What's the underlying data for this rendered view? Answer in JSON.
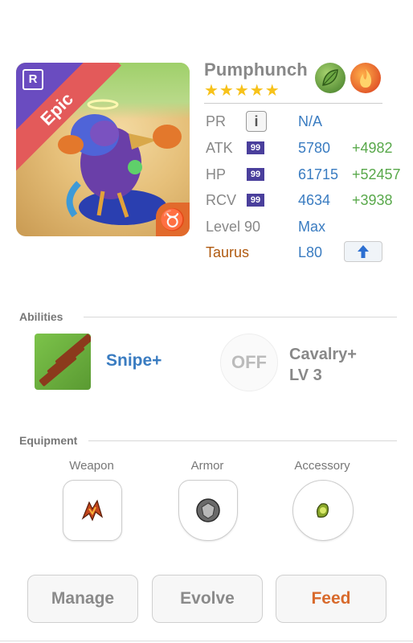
{
  "monster": {
    "name": "Pumphunch",
    "stars": "★★★★★",
    "rarity_badge": "R",
    "rarity": "Epic",
    "sign_symbol": "♉",
    "elements": [
      "leaf-icon",
      "fire-icon"
    ]
  },
  "stats": {
    "pr": {
      "label": "PR",
      "value": "N/A"
    },
    "atk": {
      "label": "ATK",
      "badge": "99",
      "value": "5780",
      "bonus": "+4982"
    },
    "hp": {
      "label": "HP",
      "badge": "99",
      "value": "61715",
      "bonus": "+52457"
    },
    "rcv": {
      "label": "RCV",
      "badge": "99",
      "value": "4634",
      "bonus": "+3938"
    },
    "level": {
      "label": "Level 90",
      "value": "Max"
    },
    "sign": {
      "label": "Taurus",
      "value": "L80"
    }
  },
  "abilities": {
    "title": "Abilities",
    "primary": {
      "name": "Snipe+"
    },
    "secondary": {
      "status": "OFF",
      "name": "Cavalry+",
      "level": "LV 3"
    }
  },
  "equipment": {
    "title": "Equipment",
    "slots": [
      {
        "label": "Weapon"
      },
      {
        "label": "Armor"
      },
      {
        "label": "Accessory"
      }
    ]
  },
  "actions": {
    "manage": "Manage",
    "evolve": "Evolve",
    "feed": "Feed"
  },
  "colors": {
    "accent_blue": "#3a7cc1",
    "bonus_green": "#58a84a",
    "epic_red": "#e35a5a",
    "feed_orange": "#d86a2c",
    "taurus_brown": "#b05a10"
  }
}
